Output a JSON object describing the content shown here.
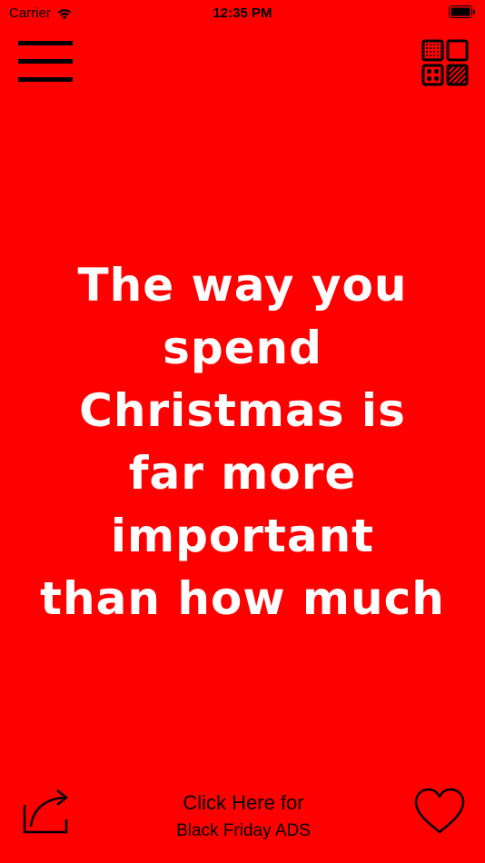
{
  "status_bar": {
    "carrier": "Carrier",
    "time": "12:35 PM",
    "wifi_icon": "wifi-icon",
    "battery_icon": "battery-icon"
  },
  "toolbar": {
    "menu_icon": "hamburger-menu-icon",
    "layout_icon": "background-pattern-grid-icon"
  },
  "quote": {
    "lines": [
      "The way you",
      "spend",
      "Christmas is",
      "far more",
      "important",
      "than how much"
    ]
  },
  "bottom_bar": {
    "share_icon": "share-icon",
    "ads_line1": "Click Here for",
    "ads_line2": "Black Friday ADS",
    "favorite_icon": "heart-icon"
  },
  "colors": {
    "background": "#ff0000",
    "quote_text": "#ffffff",
    "icons": "#000000"
  }
}
